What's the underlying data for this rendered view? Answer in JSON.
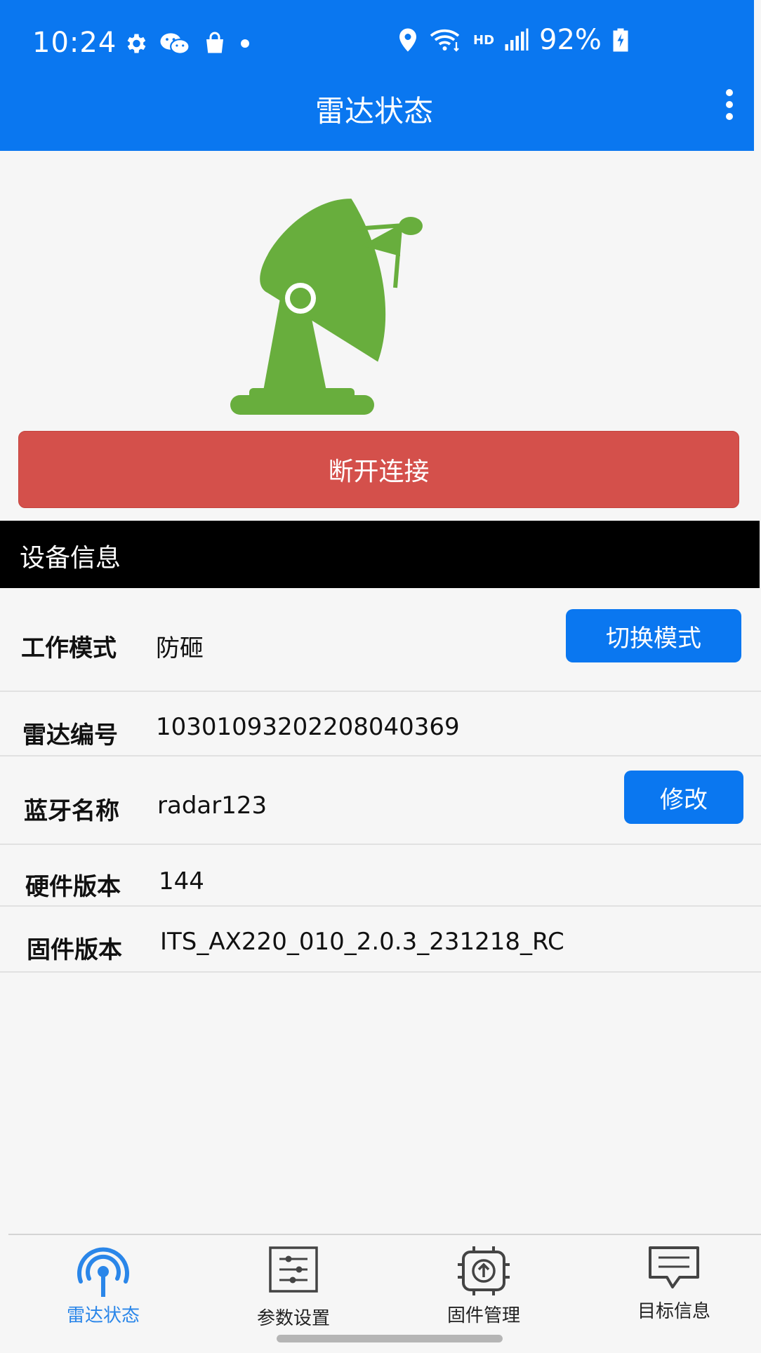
{
  "status_bar": {
    "time": "10:24",
    "hd_label": "HD",
    "battery_percent": "92%",
    "icons": [
      "gear-icon",
      "wechat-icon",
      "shopping-bag-icon",
      "notification-dot-icon",
      "location-pin-icon",
      "wifi-icon",
      "signal-icon",
      "battery-charging-icon"
    ]
  },
  "header": {
    "title": "雷达状态",
    "menu_icon": "more-vertical-icon"
  },
  "radar": {
    "icon": "radar-dish-icon",
    "color": "#68ae3d"
  },
  "disconnect_button": {
    "label": "断开连接",
    "color": "#d4504b"
  },
  "device_info": {
    "header": "设备信息",
    "rows": [
      {
        "label": "工作模式",
        "value": "防砸",
        "action": "切换模式"
      },
      {
        "label": "雷达编号",
        "value": "1030109320220804036​9"
      },
      {
        "label": "蓝牙名称",
        "value": "radar123",
        "action": "修改"
      },
      {
        "label": "硬件版本",
        "value": "144"
      },
      {
        "label": "固件版本",
        "value": "ITS_AX220_010_2.0.3_231218_RC"
      }
    ]
  },
  "bottom_nav": {
    "active_color": "#2a86e9",
    "items": [
      {
        "label": "雷达状态",
        "icon": "radar-signal-icon",
        "active": true
      },
      {
        "label": "参数设置",
        "icon": "sliders-icon",
        "active": false
      },
      {
        "label": "固件管理",
        "icon": "chip-upload-icon",
        "active": false
      },
      {
        "label": "目标信息",
        "icon": "message-icon",
        "active": false
      }
    ]
  },
  "colors": {
    "primary": "#0a77f0",
    "background": "#f6f6f6",
    "section_header": "#000000"
  }
}
